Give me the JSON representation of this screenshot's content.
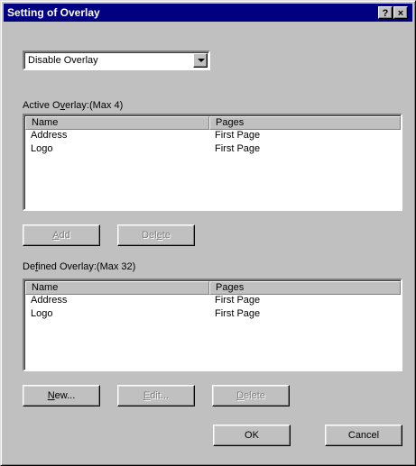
{
  "window": {
    "title": "Setting of Overlay",
    "help_button": "?",
    "close_button": "×"
  },
  "overlay_mode": {
    "selected": "Disable Overlay"
  },
  "active_overlay": {
    "label_before": "Active O",
    "label_accel": "v",
    "label_after": "erlay:(Max 4)",
    "columns": [
      "Name",
      "Pages"
    ],
    "rows": [
      {
        "name": "Address",
        "pages": "First Page"
      },
      {
        "name": "Logo",
        "pages": "First Page"
      }
    ],
    "add_before": "",
    "add_accel": "A",
    "add_after": "dd",
    "delete_before": "Del",
    "delete_accel": "e",
    "delete_after": "te"
  },
  "defined_overlay": {
    "label_before": "De",
    "label_accel": "f",
    "label_after": "ined Overlay:(Max 32)",
    "columns": [
      "Name",
      "Pages"
    ],
    "rows": [
      {
        "name": "Address",
        "pages": "First Page"
      },
      {
        "name": "Logo",
        "pages": "First Page"
      }
    ],
    "new_before": "",
    "new_accel": "N",
    "new_after": "ew...",
    "edit_before": "",
    "edit_accel": "E",
    "edit_after": "dit...",
    "delete_before": "",
    "delete_accel": "D",
    "delete_after": "elete"
  },
  "footer": {
    "ok": "OK",
    "cancel": "Cancel"
  }
}
